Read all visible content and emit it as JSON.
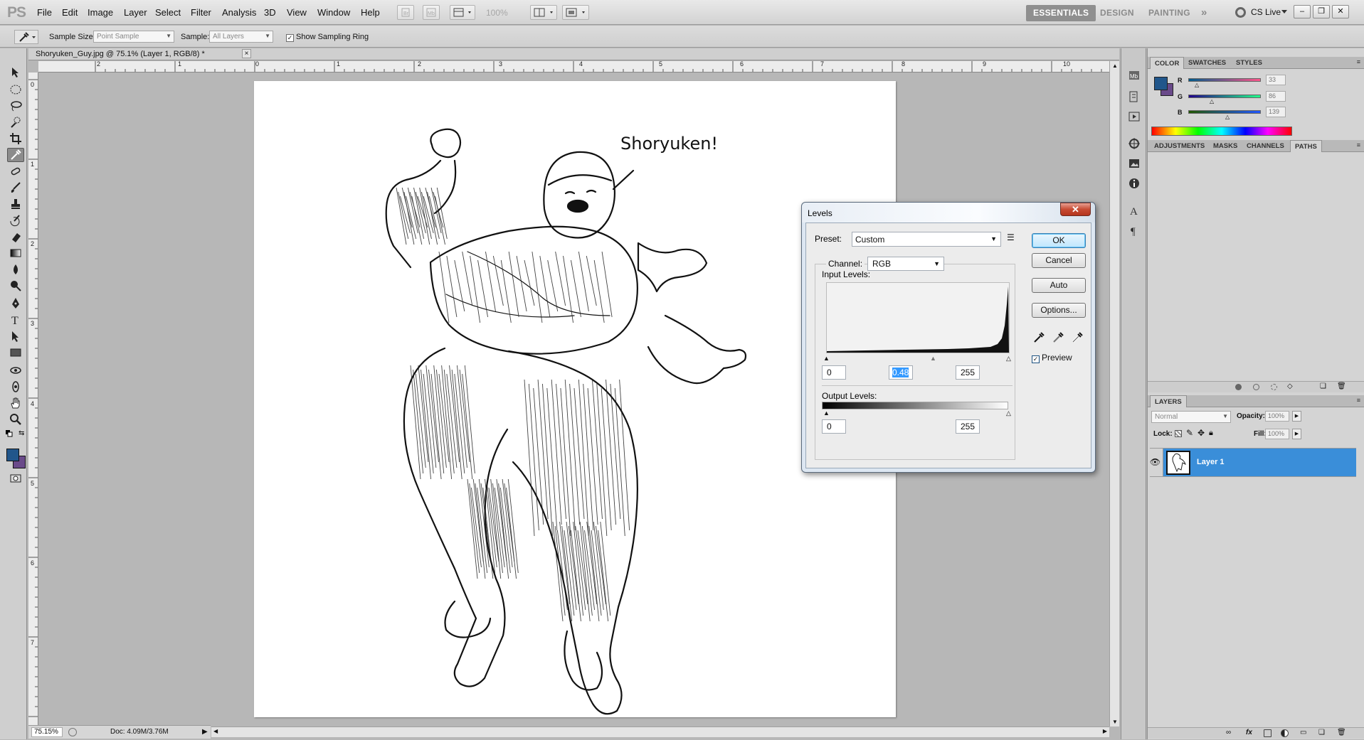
{
  "app": {
    "logo": "PS",
    "menu": [
      "File",
      "Edit",
      "Image",
      "Layer",
      "Select",
      "Filter",
      "Analysis",
      "3D",
      "View",
      "Window",
      "Help"
    ],
    "zoom_box": "100%",
    "workspaces": [
      "ESSENTIALS",
      "DESIGN",
      "PAINTING"
    ],
    "more_workspaces": "»",
    "cs_live": "CS Live"
  },
  "options_bar": {
    "sample_size_label": "Sample Size:",
    "sample_size_value": "Point Sample",
    "sample_label": "Sample:",
    "sample_value": "All Layers",
    "show_ring_label": "Show Sampling Ring",
    "show_ring_checked": true
  },
  "document": {
    "tab_title": "Shoryuken_Guy.jpg @ 75.1% (Layer 1, RGB/8) *",
    "close": "×",
    "ruler_top": [
      "2",
      "1",
      "0",
      "1",
      "2",
      "3",
      "4",
      "5",
      "6",
      "7",
      "8",
      "9",
      "10"
    ],
    "ruler_left": [
      "0",
      "1",
      "2",
      "3",
      "4",
      "5",
      "6",
      "7"
    ],
    "zoom": "75.15%",
    "doc_size": "Doc: 4.09M/3.76M",
    "speech": "Shoryuken!"
  },
  "color_panel": {
    "tabs": [
      "COLOR",
      "SWATCHES",
      "STYLES"
    ],
    "r_label": "R",
    "r": "33",
    "g_label": "G",
    "g": "86",
    "b_label": "B",
    "b": "139",
    "foreground": "#21568b",
    "background": "#6a4a8a"
  },
  "adjustments_panel": {
    "tabs": [
      "ADJUSTMENTS",
      "MASKS",
      "CHANNELS",
      "PATHS"
    ]
  },
  "layers_panel": {
    "title": "LAYERS",
    "blend_mode": "Normal",
    "opacity_label": "Opacity:",
    "opacity": "100%",
    "lock_label": "Lock:",
    "fill_label": "Fill:",
    "fill": "100%",
    "layer_name": "Layer 1"
  },
  "levels": {
    "title": "Levels",
    "close": "✕",
    "preset_label": "Preset:",
    "preset_value": "Custom",
    "channel_label": "Channel:",
    "channel_value": "RGB",
    "input_levels_label": "Input Levels:",
    "input_black": "0",
    "input_gamma": "0.48",
    "input_white": "255",
    "output_levels_label": "Output Levels:",
    "output_black": "0",
    "output_white": "255",
    "ok": "OK",
    "cancel": "Cancel",
    "auto": "Auto",
    "options": "Options...",
    "preview_label": "Preview",
    "preview_checked": true
  }
}
